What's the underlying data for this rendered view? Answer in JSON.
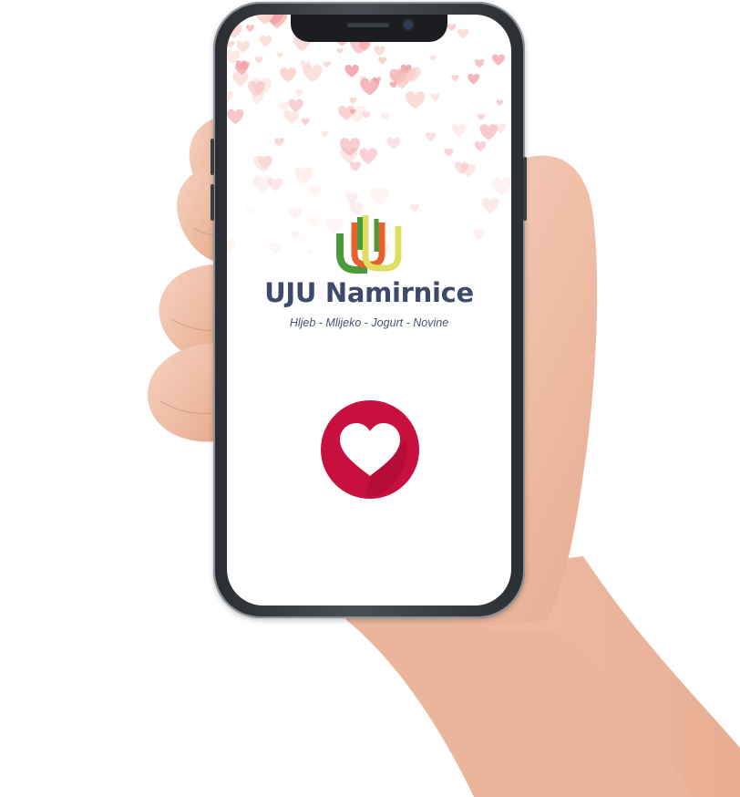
{
  "app": {
    "name": "UJU Namirnice",
    "tagline": "Hljeb - Mlijeko - Jogurt - Novine"
  },
  "icons": {
    "logo": "uju-logo-mark",
    "favorite": "heart-icon",
    "decoration": "falling-hearts-pattern"
  },
  "colors": {
    "brand_text": "#3d4a6b",
    "logo_green": "#4a9a3a",
    "logo_orange": "#e8612d",
    "logo_yellow": "#dede62",
    "favorite_circle": "#c8103f",
    "favorite_circle_shade": "#a80a34",
    "hearts": [
      "#f4a3a8",
      "#f7c2b8",
      "#f9d3cc",
      "#f08f96"
    ]
  }
}
